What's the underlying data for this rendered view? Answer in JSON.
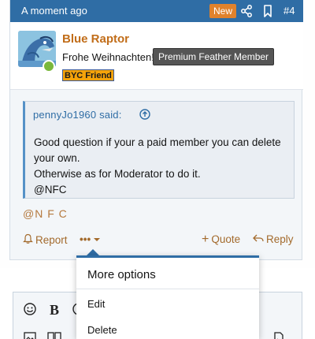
{
  "post": {
    "time": "A moment ago",
    "new_badge": "New",
    "number": "#4"
  },
  "user": {
    "name": "Blue Raptor",
    "title": "Frohe Weihnachten!",
    "premium_badge": "Premium Feather Member",
    "friend_badge": "BYC Friend"
  },
  "quote": {
    "author": "pennyJo1960 said:",
    "lines": [
      "Good question if your a paid member you can delete your own.",
      "Otherwise as for Moderator to do it.",
      "@NFC"
    ]
  },
  "signature": "@N F C",
  "actions": {
    "report": "Report",
    "more": "•••",
    "quote": "Quote",
    "reply": "Reply"
  },
  "dropdown": {
    "title": "More options",
    "items": [
      "Edit",
      "Delete"
    ]
  },
  "editor": {
    "bold": "B"
  },
  "colors": {
    "header": "#2f6da5",
    "username": "#c16d19",
    "new_badge": "#e0822c",
    "action_text": "#a36a2c"
  },
  "icons": [
    "share-icon",
    "bookmark-icon",
    "arrow-up-circle-icon",
    "bell-icon",
    "plus-icon",
    "reply-arrow-icon",
    "smiley-icon",
    "image-icon",
    "columns-icon",
    "file-icon"
  ]
}
